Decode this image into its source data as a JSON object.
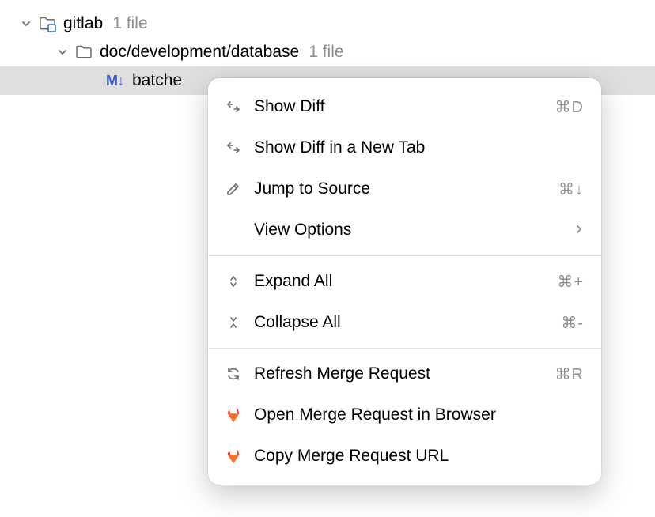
{
  "tree": {
    "root": {
      "label": "gitlab",
      "suffix": "1 file"
    },
    "folder": {
      "label": "doc/development/database",
      "suffix": "1 file"
    },
    "file": {
      "badge": "M↓",
      "label": "batche"
    }
  },
  "menu": {
    "items": [
      {
        "label": "Show Diff",
        "shortcut": "⌘D",
        "icon": "diff"
      },
      {
        "label": "Show Diff in a New Tab",
        "shortcut": "",
        "icon": "diff"
      },
      {
        "label": "Jump to Source",
        "shortcut": "⌘↓",
        "icon": "pencil"
      },
      {
        "label": "View Options",
        "shortcut": "",
        "icon": "none",
        "submenu": true
      }
    ],
    "group2": [
      {
        "label": "Expand All",
        "shortcut": "⌘+",
        "icon": "expand"
      },
      {
        "label": "Collapse All",
        "shortcut": "⌘-",
        "icon": "collapse"
      }
    ],
    "group3": [
      {
        "label": "Refresh Merge Request",
        "shortcut": "⌘R",
        "icon": "refresh"
      },
      {
        "label": "Open Merge Request in Browser",
        "shortcut": "",
        "icon": "gitlab"
      },
      {
        "label": "Copy Merge Request URL",
        "shortcut": "",
        "icon": "gitlab"
      }
    ]
  }
}
